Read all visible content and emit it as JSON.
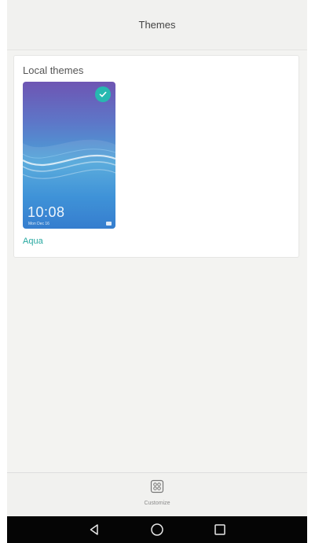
{
  "header": {
    "title": "Themes"
  },
  "local_themes": {
    "section_title": "Local themes",
    "items": [
      {
        "name": "Aqua",
        "selected": true,
        "preview_time": "10:08",
        "preview_date": "Mon Dec 16",
        "check_icon": "check-icon"
      }
    ]
  },
  "bottom_bar": {
    "customize_label": "Customize",
    "customize_icon": "customize-grid-icon"
  },
  "system_nav": {
    "back_icon": "back-triangle-icon",
    "home_icon": "home-circle-icon",
    "recents_icon": "recents-square-icon"
  },
  "colors": {
    "accent": "#27b8b0",
    "background": "#f3f3f1",
    "nav_bar": "#050505"
  }
}
